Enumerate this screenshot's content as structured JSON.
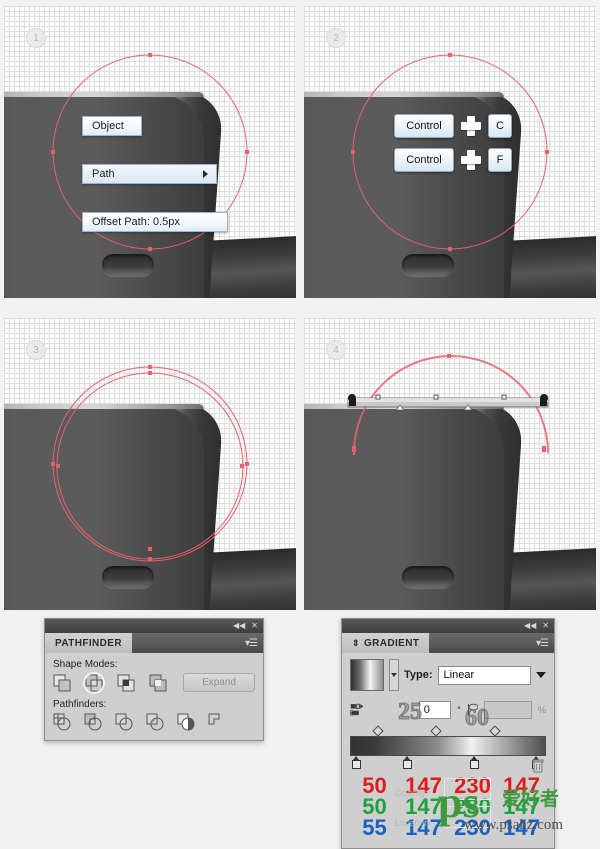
{
  "tutorial": {
    "steps": [
      {
        "badge": "1",
        "name": "offset-path-menu"
      },
      {
        "badge": "2",
        "name": "copy-paste-shortcuts"
      },
      {
        "badge": "3",
        "name": "two-concentric-paths"
      },
      {
        "badge": "4",
        "name": "gradient-applied"
      }
    ]
  },
  "context_menu": {
    "object_label": "Object",
    "path_label": "Path",
    "submenu_arrow": "submenu-arrow-icon",
    "offset_path_label": "Offset Path: 0.5px"
  },
  "shortcuts": {
    "rows": [
      {
        "modifier": "Control",
        "plus": "plus-icon",
        "key": "C"
      },
      {
        "modifier": "Control",
        "plus": "plus-icon",
        "key": "F"
      }
    ]
  },
  "pathfinder_panel": {
    "title": "PATHFINDER",
    "collapse_icon": "collapse-icon",
    "close_icon": "close-icon",
    "menu_icon": "panel-menu-icon",
    "shape_modes_label": "Shape Modes:",
    "shape_modes": [
      {
        "name": "unite",
        "selected": false
      },
      {
        "name": "minus-front",
        "selected": true
      },
      {
        "name": "intersect",
        "selected": false
      },
      {
        "name": "exclude",
        "selected": false
      }
    ],
    "expand_label": "Expand",
    "pathfinders_label": "Pathfinders:",
    "pathfinders": [
      {
        "name": "divide"
      },
      {
        "name": "trim"
      },
      {
        "name": "merge"
      },
      {
        "name": "crop"
      },
      {
        "name": "outline"
      },
      {
        "name": "minus-back"
      }
    ]
  },
  "gradient_panel": {
    "title": "GRADIENT",
    "collapse_icon": "collapse-icon",
    "close_icon": "close-icon",
    "menu_icon": "panel-menu-icon",
    "expand_arrows_icon": "expand-arrows-icon",
    "swatch_icon": "gradient-swatch",
    "type_label": "Type:",
    "type_value": "Linear",
    "reverse_icon": "reverse-gradient-icon",
    "angle_value": "0",
    "degree_symbol": "°",
    "aspect_icon": "aspect-ratio-icon",
    "aspect_value": "",
    "percent_symbol": "%",
    "ghost_numbers": [
      "25",
      "60"
    ],
    "opacity_label": "Opacity:",
    "location_label": "Location:",
    "trash_icon": "delete-stop-icon",
    "stops": [
      {
        "position": 0,
        "r": "50",
        "g": "50",
        "b": "55"
      },
      {
        "position": 25,
        "r": "147",
        "g": "147",
        "b": "147"
      },
      {
        "position": 60,
        "r": "230",
        "g": "230",
        "b": "230"
      },
      {
        "position": 100,
        "r": "147",
        "g": "147",
        "b": "147"
      }
    ]
  },
  "colors": {
    "accent_red": "#e01b1b",
    "accent_green": "#18a33c",
    "accent_blue": "#1661c4",
    "path_stroke": "#e8616b",
    "panel_bg": "#cfcfcf",
    "canvas_bg": "#f2f2f2"
  },
  "watermark": {
    "logo_text": "ps",
    "cn_text": "爱好者",
    "url": "www.psahz.com"
  }
}
